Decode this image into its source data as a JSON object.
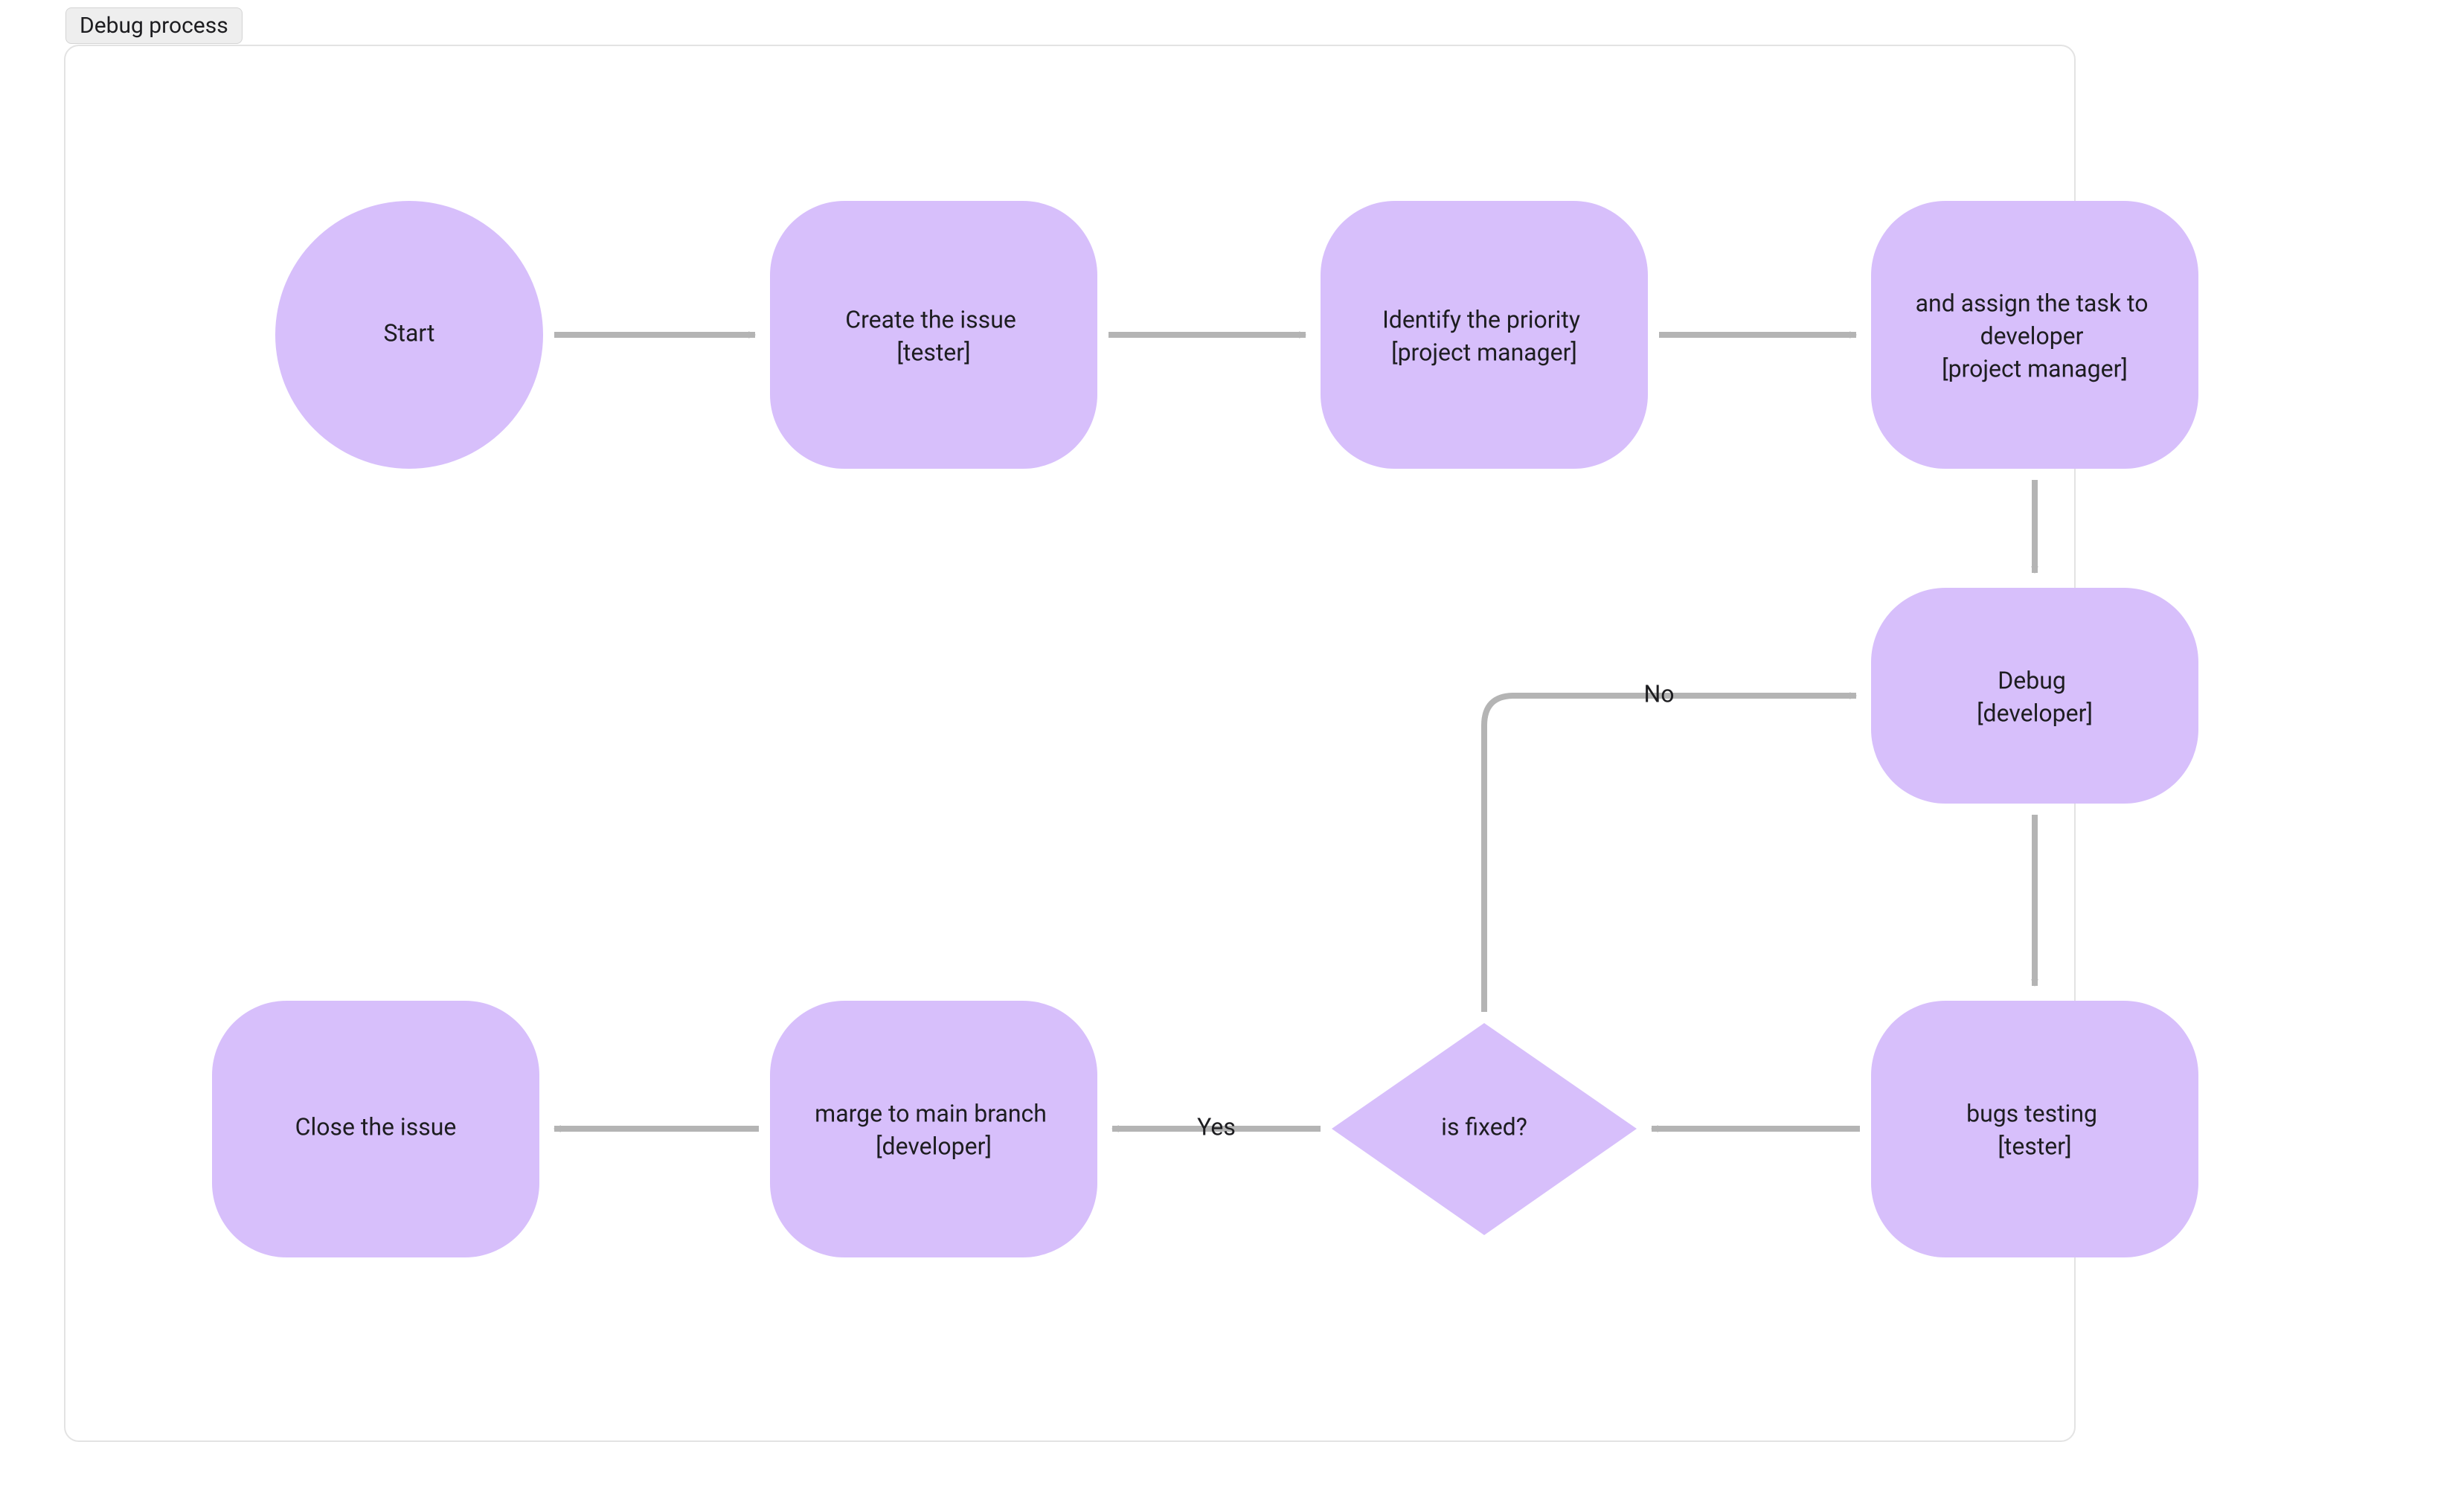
{
  "title": "Debug process",
  "nodes": {
    "start": {
      "label1": "Start",
      "label2": "",
      "label3": ""
    },
    "create_issue": {
      "label1": "Create the issue",
      "label2": "[tester]",
      "label3": ""
    },
    "identify": {
      "label1": "Identify the priority",
      "label2": "[project manager]",
      "label3": ""
    },
    "assign": {
      "label1": "and assign the task to",
      "label2": "developer",
      "label3": "[project manager]"
    },
    "debug": {
      "label1": "Debug",
      "label2": "[developer]",
      "label3": ""
    },
    "bugs_testing": {
      "label1": "bugs testing",
      "label2": "[tester]",
      "label3": ""
    },
    "is_fixed": {
      "label1": "is fixed?",
      "label2": "",
      "label3": ""
    },
    "merge": {
      "label1": "marge to main branch",
      "label2": "[developer]",
      "label3": ""
    },
    "close": {
      "label1": "Close the issue",
      "label2": "",
      "label3": ""
    }
  },
  "edge_labels": {
    "no": "No",
    "yes": "Yes"
  },
  "colors": {
    "node_fill": "#d7bffb",
    "edge_stroke": "#b4b4b4",
    "text": "#1d1d20"
  }
}
